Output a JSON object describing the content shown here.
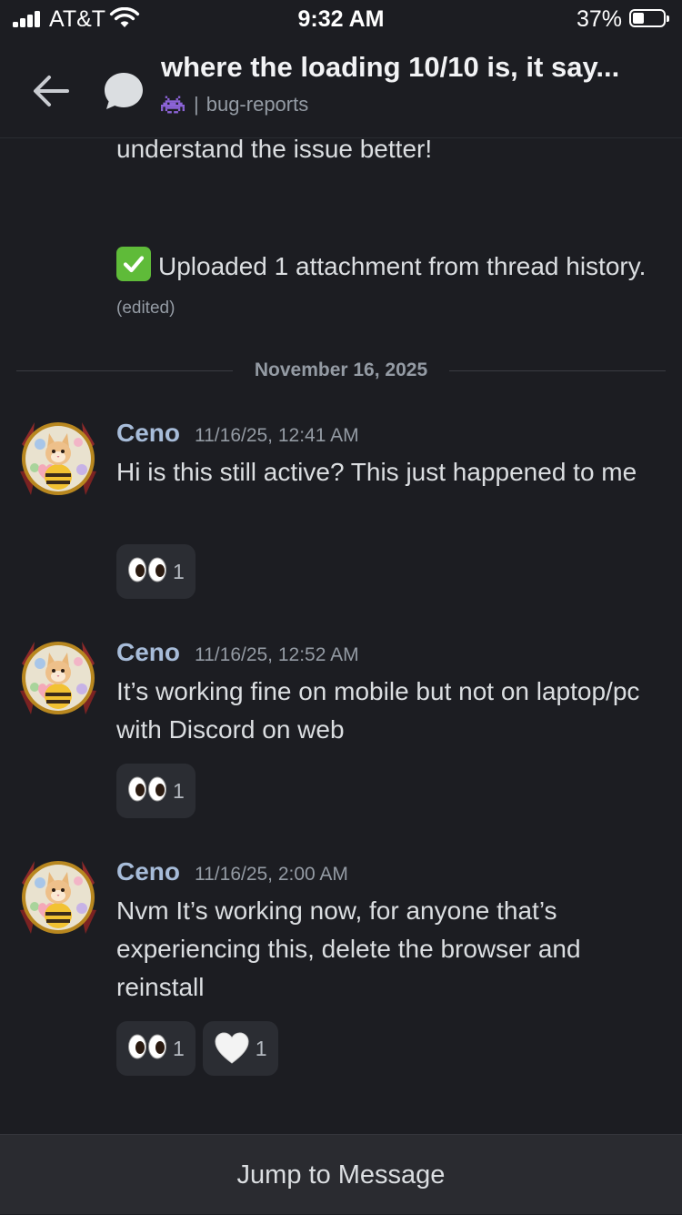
{
  "status_bar": {
    "carrier": "AT&T",
    "time": "9:32 AM",
    "battery_percent": "37%",
    "battery_level": 0.37
  },
  "header": {
    "thread_title": "where the loading 10/10 is, it say...",
    "channel_separator": "|",
    "channel_name": "bug-reports",
    "channel_icon": "space-invader-icon"
  },
  "messages_above": {
    "partial_text": "understand the issue better!",
    "uploaded_text": "Uploaded 1 attachment from thread history.",
    "edited_label": "(edited)",
    "check_icon": "check-mark-button-icon"
  },
  "date_divider": "November 16, 2025",
  "messages": [
    {
      "author": "Ceno",
      "timestamp": "11/16/25, 12:41 AM",
      "content": "Hi is this still active? This just happened to me",
      "reactions": [
        {
          "emoji": "eyes-icon",
          "count": "1"
        }
      ]
    },
    {
      "author": "Ceno",
      "timestamp": "11/16/25, 12:52 AM",
      "content": "It’s working fine on mobile but not on laptop/pc with Discord on web",
      "reactions": [
        {
          "emoji": "eyes-icon",
          "count": "1"
        }
      ]
    },
    {
      "author": "Ceno",
      "timestamp": "11/16/25, 2:00 AM",
      "content": "Nvm It’s working now, for anyone that’s experiencing this, delete the browser and reinstall",
      "reactions": [
        {
          "emoji": "eyes-icon",
          "count": "1"
        },
        {
          "emoji": "white-heart-icon",
          "count": "1"
        }
      ]
    }
  ],
  "footer": {
    "jump_label": "Jump to Message"
  },
  "colors": {
    "background": "#1c1d22",
    "username": "#a7bcd9",
    "muted": "#949ba4",
    "reaction_bg": "#2b2d33",
    "check_green": "#5fbb39"
  }
}
